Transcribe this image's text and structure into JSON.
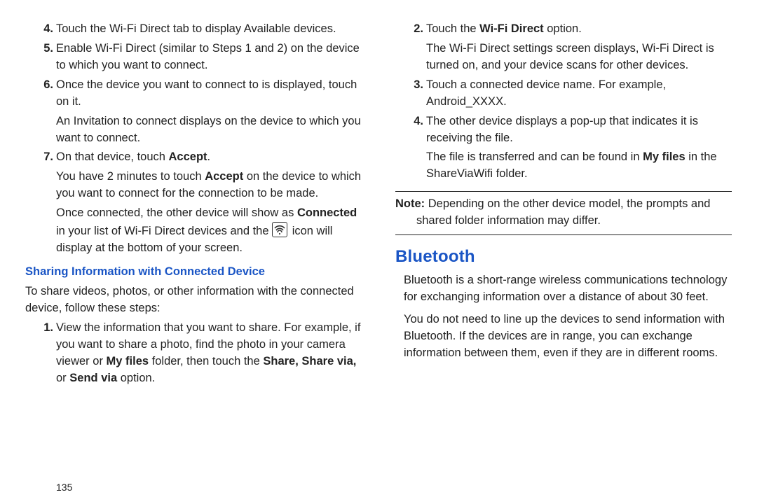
{
  "left": {
    "step4": "Touch the Wi-Fi Direct tab to display Available devices.",
    "step5": "Enable Wi-Fi Direct (similar to Steps 1 and 2) on the device to which you want to connect.",
    "step6": "Once the device you want to connect to is displayed, touch on it.",
    "step6_sub": "An Invitation to connect displays on the device to which you want to connect.",
    "step7_pre": "On that device, touch ",
    "step7_b": "Accept",
    "step7_post": ".",
    "step7_sub1_pre": "You have 2 minutes to touch ",
    "step7_sub1_b": "Accept",
    "step7_sub1_post": " on the device to which you want to connect for the connection to be made.",
    "step7_sub2_pre": "Once connected, the other device will show as ",
    "step7_sub2_b": "Connected",
    "step7_sub2_mid": " in your list of Wi-Fi Direct devices and the ",
    "step7_sub2_post": " icon will display at the bottom of your screen.",
    "share_heading": "Sharing Information with Connected Device",
    "share_intro": "To share videos, photos, or other information with the connected device, follow these steps:",
    "share_step1_pre": "View the information that you want to share. For example, if you want to share a photo, find the photo in your camera viewer or ",
    "share_step1_b1": "My files",
    "share_step1_mid": " folder, then touch the ",
    "share_step1_b2": "Share, Share via,",
    "share_step1_mid2": " or ",
    "share_step1_b3": "Send via",
    "share_step1_post": " option."
  },
  "right": {
    "step2_pre": "Touch the ",
    "step2_b": "Wi-Fi Direct",
    "step2_post": " option.",
    "step2_sub": "The Wi-Fi Direct settings screen displays, Wi-Fi Direct is turned on, and your device scans for other devices.",
    "step3": "Touch a connected device name. For example, Android_XXXX.",
    "step4": "The other device displays a pop-up that indicates it is receiving the file.",
    "step4_sub_pre": "The file is transferred and can be found in ",
    "step4_sub_b": "My files",
    "step4_sub_post": " in the ShareViaWifi folder.",
    "note_label": "Note:",
    "note_text": " Depending on the other device model, the prompts and shared folder information may differ.",
    "bt_heading": "Bluetooth",
    "bt_p1": "Bluetooth is a short-range wireless communications technology for exchanging information over a distance of about 30 feet.",
    "bt_p2": "You do not need to line up the devices to send information with Bluetooth. If the devices are in range, you can exchange information between them, even if they are in different rooms."
  },
  "page_number": "135"
}
